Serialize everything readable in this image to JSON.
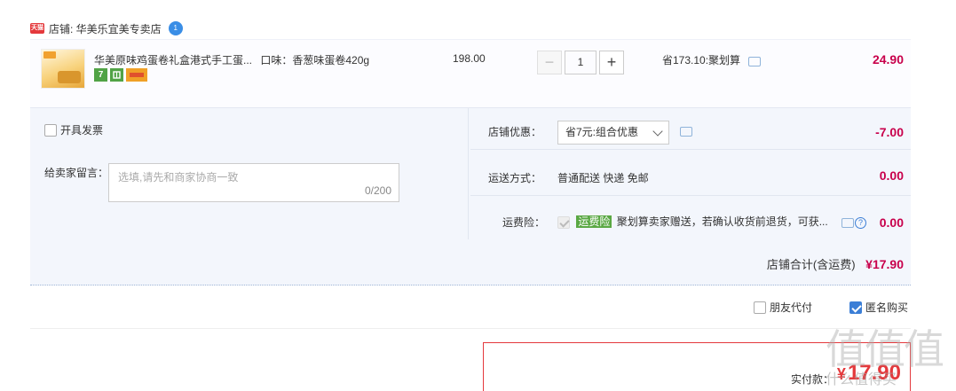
{
  "shop": {
    "badge": "天猫",
    "name": "店铺: 华美乐宜美专卖店",
    "ww_badge": "1"
  },
  "item": {
    "title": "华美原味鸡蛋卷礼盒港式手工蛋...",
    "flavor": "口味：香葱味蛋卷420g",
    "badge_7": "7",
    "price": "198.00",
    "qty": "1",
    "qty_minus": "−",
    "qty_plus": "+",
    "saving": "省173.10:聚划算",
    "total": "24.90"
  },
  "options": {
    "invoice_label": "开具发票",
    "message_label": "给卖家留言：",
    "message_placeholder": "选填,请先和商家协商一致",
    "message_count": "0/200",
    "promo_label": "店铺优惠：",
    "promo_selected": "省7元:组合优惠",
    "promo_value": "-7.00",
    "ship_label": "运送方式：",
    "ship_method": "普通配送 快递 免邮",
    "ship_value": "0.00",
    "ins_label": "运费险：",
    "ins_tag": "运费险",
    "ins_text": "聚划算卖家赠送，若确认收货前退货，可获...",
    "ins_value": "0.00"
  },
  "shop_total": {
    "label": "店铺合计(含运费)",
    "value": "¥17.90"
  },
  "extras": {
    "friend_pay": "朋友代付",
    "anonymous": "匿名购买"
  },
  "pay": {
    "label": "实付款：",
    "currency": "¥",
    "amount": "17.90"
  },
  "watermark": {
    "glyphs": "值值值",
    "site": "什么值得买"
  },
  "colors": {
    "price_red": "#c8004b",
    "pay_red": "#e4393c",
    "panel_bg": "#f3f6fc",
    "check_blue": "#3b7ed6",
    "ins_green": "#5aa844"
  },
  "icons": [
    "tmall-icon",
    "wangwang-icon",
    "message-icon",
    "help-icon",
    "chevron-down-icon"
  ]
}
